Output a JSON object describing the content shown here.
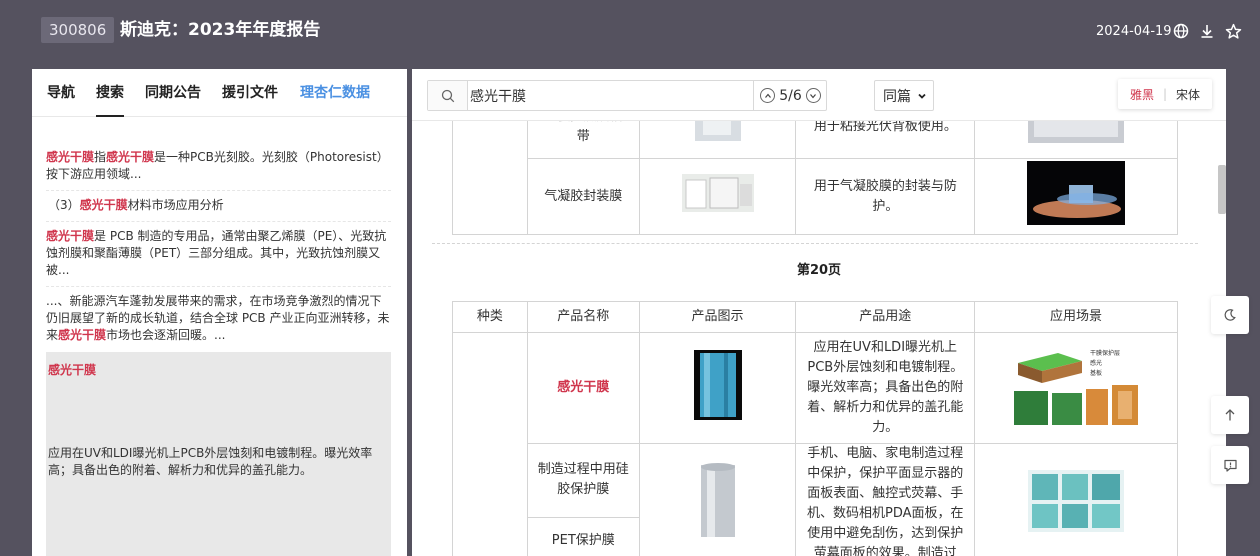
{
  "header": {
    "stock_code": "300806",
    "title": "斯迪克：2023年年度报告",
    "date": "2024-04-19"
  },
  "left_tabs": [
    {
      "label": "导航"
    },
    {
      "label": "搜索"
    },
    {
      "label": "同期公告"
    },
    {
      "label": "援引文件"
    },
    {
      "label": "理杏仁数据"
    }
  ],
  "results": [
    {
      "hl": "感光干膜",
      "mid": "指",
      "hl2": "感光干膜",
      "rest": "是一种PCB光刻胶。光刻胶（Photoresist）按下游应用领域..."
    },
    {
      "pre": "（3）",
      "hl": "感光干膜",
      "rest": "材料市场应用分析"
    },
    {
      "hl": "感光干膜",
      "rest": "是 PCB 制造的专用品，通常由聚乙烯膜（PE）、光致抗蚀剂膜和聚酯薄膜（PET）三部分组成。其中，光致抗蚀剂膜又被..."
    },
    {
      "pre": "...、新能源汽车蓬勃发展带来的需求，在市场竞争激烈的情况下仍旧展望了新的成长轨道，结合全球 PCB 产业正向亚洲转移，未来",
      "hl": "感光干膜",
      "rest": "市场也会逐渐回暖。..."
    }
  ],
  "selected": {
    "title": "感光干膜",
    "text": "应用在UV和LDI曝光机上PCB外层蚀刻和电镀制程。曝光效率高；具备出色的附着、解析力和优异的盖孔能力。"
  },
  "search": {
    "query": "感光干膜",
    "position": "5/6",
    "scope": "同篇",
    "font_a": "雅黑",
    "font_b": "宋体"
  },
  "doc": {
    "top_rows": [
      {
        "name": "光伏阻燃胶粘带",
        "name_visible": "光伏阻燃胶粘\n带",
        "use": "用于粘接光伏背板使用。"
      },
      {
        "name": "气凝胶封装膜",
        "use": "用于气凝胶膜的封装与防护。"
      }
    ],
    "page_label": "第20页",
    "headers": [
      "种类",
      "产品名称",
      "产品图示",
      "产品用途",
      "应用场景"
    ],
    "rows": [
      {
        "name": "感光干膜",
        "use": "应用在UV和LDI曝光机上PCB外层蚀刻和电镀制程。曝光效率高；具备出色的附着、解析力和优异的盖孔能力。",
        "scene_labels": [
          "干膜保护层",
          "感光",
          "基板"
        ]
      },
      {
        "name": "制造过程中用硅胶保护膜",
        "use": "手机、电脑、家电制造过程中保护，保护平面显示器的面板表面、触控式荧幕、手机、数码相机PDA面板，在使用中避免刮伤，达到保护萤幕面板的效果。制造过"
      },
      {
        "name": "PET保护膜"
      }
    ]
  },
  "colors": {
    "highlight": "#d0364d",
    "link_blue": "#4a90e2",
    "header_bg": "#55525f"
  }
}
